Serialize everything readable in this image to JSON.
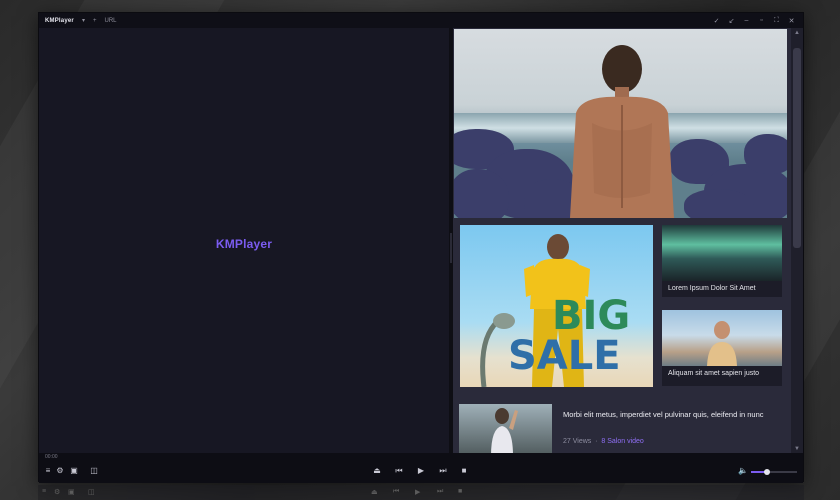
{
  "window": {
    "app_name": "KMPlayer",
    "title_menu_arrow": "▾",
    "add_label": "+",
    "url_label": "URL"
  },
  "video": {
    "logo_text": "KMPlayer"
  },
  "side_panel": {
    "cards": [
      {
        "caption": "Lorem Ipsum Dolor Sit Amet"
      },
      {
        "caption": "Aliquam sit amet sapien justo"
      }
    ],
    "ad": {
      "line1": "BIG",
      "line2": "SALE"
    },
    "list_item": {
      "title": "Morbi elit metus, imperdiet vel pulvinar quis, eleifend in nunc",
      "views": "27 Views",
      "separator": "·",
      "channel": "8 Salon video"
    }
  },
  "player": {
    "timecode": "00:00",
    "volume_level": 0.35
  },
  "colors": {
    "accent": "#7b5cf0",
    "window_bg": "#141420",
    "panel_bg": "#2a2a3a"
  },
  "icons": {
    "title_controls": [
      "pin-icon",
      "mini-icon",
      "minimize-icon",
      "maximize-icon",
      "fullscreen-icon",
      "close-icon"
    ],
    "left_controls": [
      "playlist-icon",
      "settings-icon",
      "capture-icon",
      "vr-icon"
    ],
    "center_controls": [
      "eject-icon",
      "prev-icon",
      "play-icon",
      "next-icon",
      "stop-icon"
    ],
    "right_controls": [
      "volume-icon"
    ]
  }
}
